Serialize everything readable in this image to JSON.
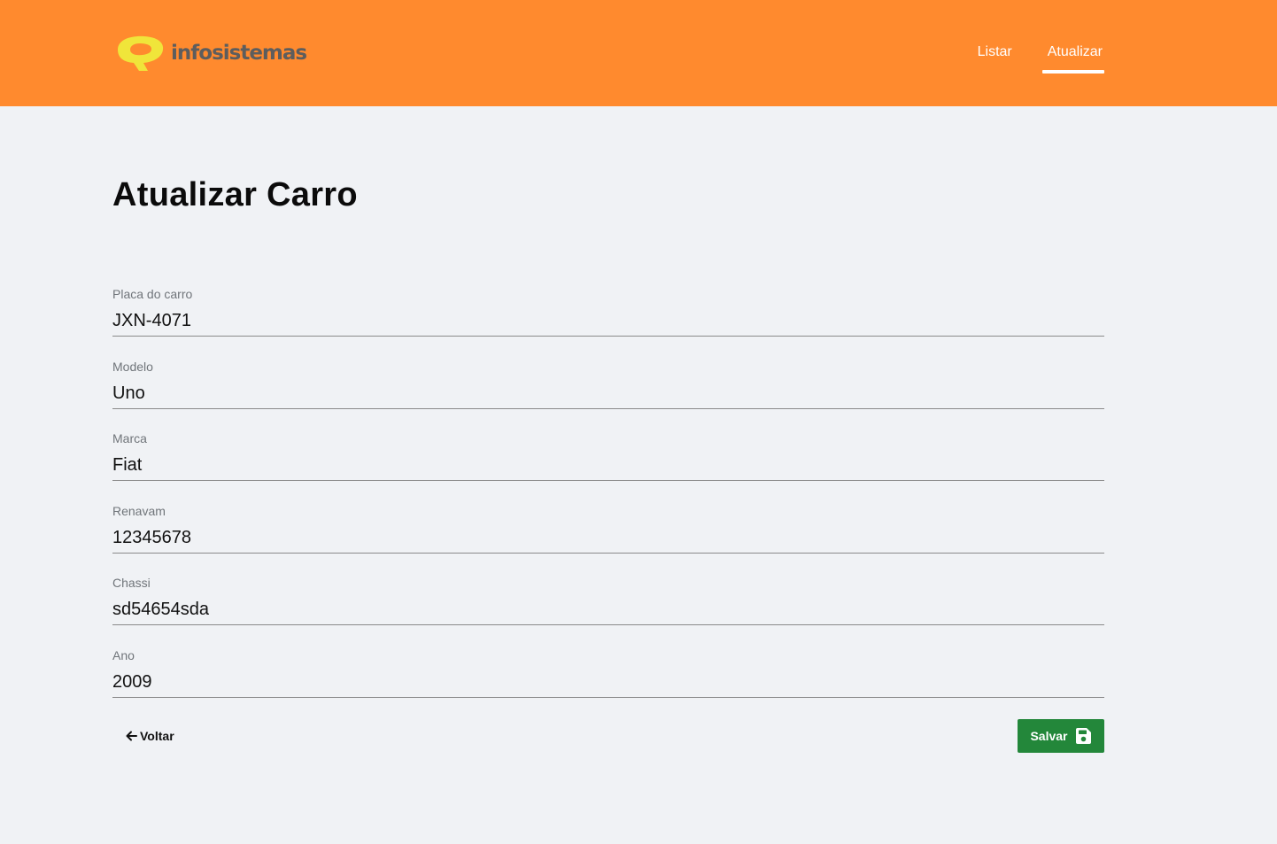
{
  "header": {
    "brand": "infosistemas",
    "accent_color": "#ff8a2e",
    "nav": [
      {
        "label": "Listar",
        "active": false
      },
      {
        "label": "Atualizar",
        "active": true
      }
    ]
  },
  "page": {
    "title": "Atualizar Carro"
  },
  "form": {
    "fields": [
      {
        "label": "Placa do carro",
        "value": "JXN-4071"
      },
      {
        "label": "Modelo",
        "value": "Uno"
      },
      {
        "label": "Marca",
        "value": "Fiat"
      },
      {
        "label": "Renavam",
        "value": "12345678"
      },
      {
        "label": "Chassi",
        "value": "sd54654sda"
      },
      {
        "label": "Ano",
        "value": "2009"
      }
    ]
  },
  "actions": {
    "back_label": "Voltar",
    "back_icon": "arrow-left-icon",
    "save_label": "Salvar",
    "save_icon": "floppy-disk-icon",
    "save_color": "#23873a"
  }
}
